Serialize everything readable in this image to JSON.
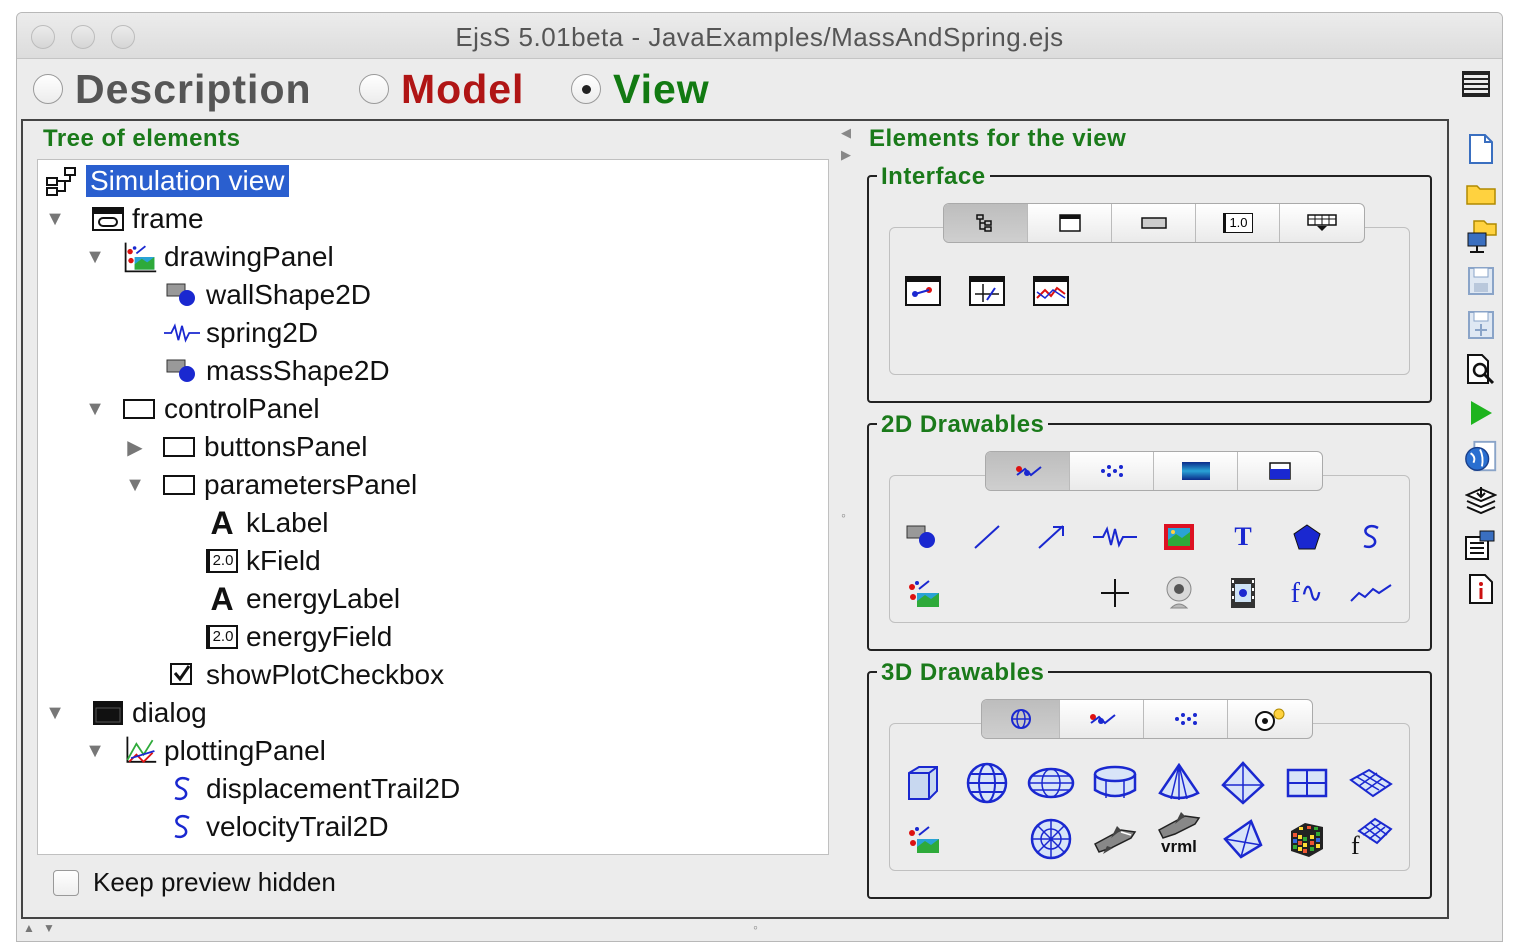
{
  "window": {
    "title": "EjsS 5.01beta - JavaExamples/MassAndSpring.ejs"
  },
  "modes": [
    {
      "label": "Description",
      "color": "#555555",
      "selected": false
    },
    {
      "label": "Model",
      "color": "#b01515",
      "selected": false
    },
    {
      "label": "View",
      "color": "#127a12",
      "selected": true
    }
  ],
  "tree": {
    "title": "Tree of elements",
    "items": [
      {
        "label": "Simulation view",
        "icon": "hierarchy-icon"
      },
      {
        "label": "frame",
        "icon": "frame-icon"
      },
      {
        "label": "drawingPanel",
        "icon": "drawing-panel-icon"
      },
      {
        "label": "wallShape2D",
        "icon": "shape2d-icon"
      },
      {
        "label": "spring2D",
        "icon": "spring-icon"
      },
      {
        "label": "massShape2D",
        "icon": "shape2d-icon"
      },
      {
        "label": "controlPanel",
        "icon": "panel-icon"
      },
      {
        "label": "buttonsPanel",
        "icon": "panel-icon"
      },
      {
        "label": "parametersPanel",
        "icon": "panel-icon"
      },
      {
        "label": "kLabel",
        "icon": "label-icon"
      },
      {
        "label": "kField",
        "icon": "number-field-icon"
      },
      {
        "label": "energyLabel",
        "icon": "label-icon"
      },
      {
        "label": "energyField",
        "icon": "number-field-icon"
      },
      {
        "label": "showPlotCheckbox",
        "icon": "checkbox-icon"
      },
      {
        "label": "dialog",
        "icon": "dialog-icon"
      },
      {
        "label": "plottingPanel",
        "icon": "plotting-panel-icon"
      },
      {
        "label": "displacementTrail2D",
        "icon": "trail-icon"
      },
      {
        "label": "velocityTrail2D",
        "icon": "trail-icon"
      }
    ],
    "field_glyph": "2.0",
    "label_glyph": "A",
    "keep_preview_label": "Keep preview hidden"
  },
  "elements": {
    "title": "Elements for the view",
    "interface": {
      "title": "Interface",
      "tab_field_glyph": "1.0",
      "tabs": [
        "containers-tab-icon",
        "window-tab-icon",
        "button-tab-icon",
        "number-field-tab-icon",
        "table-tab-icon"
      ],
      "items": [
        "drawing-panel-element-icon",
        "plotting-panel-element-icon",
        "graph-panel-element-icon"
      ]
    },
    "drawables2d": {
      "title": "2D Drawables",
      "tabs": [
        "basic-drawables-tab-icon",
        "sets-tab-icon",
        "fields-tab-icon",
        "misc-tab-icon"
      ],
      "items": [
        "shape-icon",
        "segment-icon",
        "arrow-icon",
        "spring-element-icon",
        "image-icon",
        "text-icon",
        "polygon-icon",
        "trail-element-icon",
        "group-icon",
        "cross-icon",
        "camera-icon",
        "video-icon",
        "function-icon",
        "trace-icon"
      ],
      "text_glyph": "T",
      "function_glyph": "f∿"
    },
    "drawables3d": {
      "title": "3D Drawables",
      "tabs": [
        "basic-3d-tab-icon",
        "sets-3d-tab-icon",
        "points-3d-tab-icon",
        "light-tab-icon"
      ],
      "items": [
        "cube-icon",
        "sphere-icon",
        "ellipsoid-icon",
        "cylinder-icon",
        "cone-icon",
        "pyramid-icon",
        "plane-icon",
        "surface-icon",
        "group-3d-icon",
        "disk-icon",
        "shuttle-icon",
        "vrml-icon",
        "tetrahedron-icon",
        "rubik-cube-icon",
        "function-surface-icon"
      ],
      "vrml_label": "vrml",
      "function_glyph": "f"
    }
  },
  "toolbar": {
    "buttons": [
      "new-file-icon",
      "open-folder-icon",
      "open-web-icon",
      "save-icon",
      "save-as-icon",
      "search-icon",
      "run-icon",
      "web-browser-icon",
      "stack-icon",
      "options-icon",
      "info-icon"
    ]
  },
  "colors": {
    "accent_green": "#1a7a1a",
    "selection_blue": "#2a5fcf",
    "icon_blue": "#1a28d0"
  }
}
